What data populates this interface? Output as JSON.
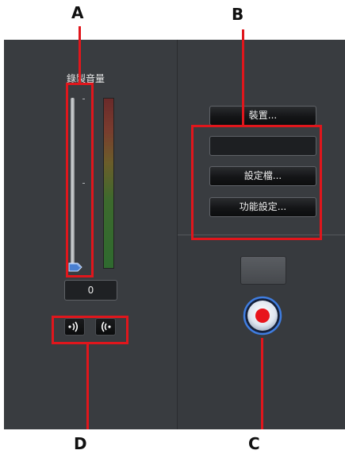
{
  "callouts": {
    "a": "A",
    "b": "B",
    "c": "C",
    "d": "D"
  },
  "recording": {
    "volume_label": "錄製音量",
    "volume_value": "0",
    "volume_level": 0
  },
  "device_panel": {
    "device_button": "裝置...",
    "profile_value": "",
    "profile_button": "設定檔...",
    "settings_button": "功能設定..."
  },
  "colors": {
    "callout_red": "#e0161c",
    "panel_bg": "#393c40",
    "record_red": "#e8141c"
  },
  "icons": {
    "slider_thumb": "slider-thumb-icon",
    "output_sound": "speaker-out-icon",
    "input_sound": "speaker-in-icon",
    "record": "record-icon"
  }
}
